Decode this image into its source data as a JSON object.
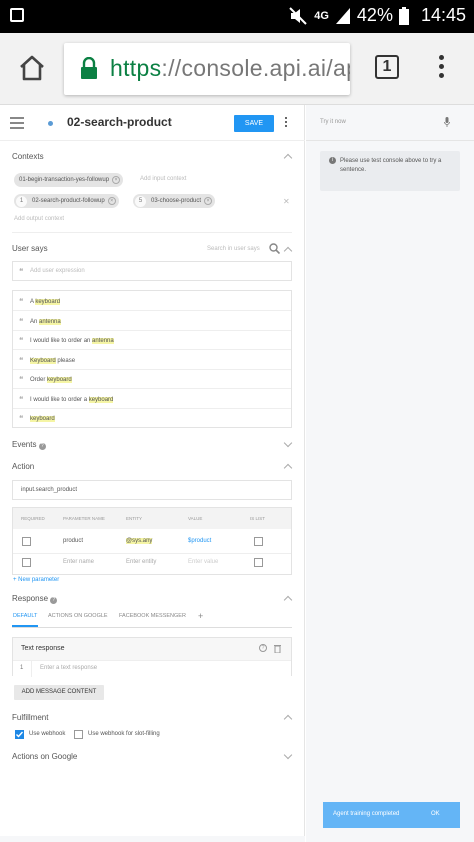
{
  "status_bar": {
    "network": "4G",
    "battery": "42%",
    "time": "14:45",
    "icons": [
      "image-icon",
      "mute-icon",
      "signal-icon",
      "battery-icon"
    ]
  },
  "browser": {
    "url_scheme": "https",
    "url_rest": "://console.api.ai/ap",
    "tab_count": "1"
  },
  "topbar": {
    "intent_name": "02-search-product",
    "save_label": "SAVE"
  },
  "contexts": {
    "title": "Contexts",
    "input_contexts": [
      "01-begin-transaction-yes-followup"
    ],
    "input_placeholder": "Add input context",
    "output_contexts": [
      {
        "lifespan": "1",
        "name": "02-search-product-followup"
      },
      {
        "lifespan": "5",
        "name": "03-choose-product"
      }
    ],
    "output_placeholder": "Add output context"
  },
  "user_says": {
    "title": "User says",
    "search_placeholder": "Search in user says",
    "add_placeholder": "Add user expression",
    "expressions": [
      {
        "pre": "A ",
        "hl": "keyboard",
        "post": ""
      },
      {
        "pre": "An ",
        "hl": "antenna",
        "post": ""
      },
      {
        "pre": "I would like to order an ",
        "hl": "antenna",
        "post": ""
      },
      {
        "pre": "",
        "hl": "Keyboard",
        "post": " please"
      },
      {
        "pre": "Order ",
        "hl": "keyboard",
        "post": ""
      },
      {
        "pre": "I would like to order a ",
        "hl": "keyboard",
        "post": ""
      },
      {
        "pre": "",
        "hl": "keyboard",
        "post": ""
      }
    ]
  },
  "events": {
    "title": "Events"
  },
  "action": {
    "title": "Action",
    "value": "input.search_product",
    "headers": {
      "required": "REQUIRED",
      "param_name": "PARAMETER NAME",
      "entity": "ENTITY",
      "value": "VALUE",
      "is_list": "IS LIST"
    },
    "row": {
      "name": "product",
      "entity": "@sys.any",
      "value": "$product"
    },
    "new_row": {
      "name_placeholder": "Enter name",
      "entity_placeholder": "Enter entity",
      "value_placeholder": "Enter value"
    },
    "new_parameter": "+ New parameter"
  },
  "response": {
    "title": "Response",
    "tabs": [
      "DEFAULT",
      "ACTIONS ON GOOGLE",
      "FACEBOOK MESSENGER"
    ],
    "add_tab": "+",
    "card_title": "Text response",
    "row_number": "1",
    "text_placeholder": "Enter a text response",
    "add_message": "ADD MESSAGE CONTENT"
  },
  "fulfillment": {
    "title": "Fulfillment",
    "use_webhook": "Use webhook",
    "slot_filling": "Use webhook for slot-filling"
  },
  "actions_on_google": {
    "title": "Actions on Google"
  },
  "right_panel": {
    "try_it": "Try it now",
    "notice": "Please use test console above to try a sentence.",
    "toast": "Agent training completed",
    "toast_ok": "OK"
  },
  "colors": {
    "accent": "#2196f3",
    "url_green": "#0b8043",
    "highlight": "#f5f5a5"
  }
}
